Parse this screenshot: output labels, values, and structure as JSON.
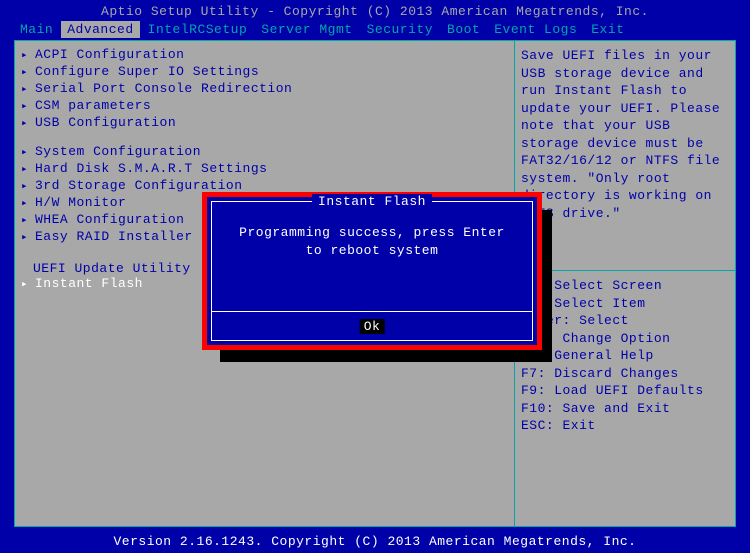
{
  "header": {
    "title": "Aptio Setup Utility - Copyright (C) 2013 American Megatrends, Inc."
  },
  "tabs": [
    {
      "label": "Main",
      "active": false
    },
    {
      "label": "Advanced",
      "active": true
    },
    {
      "label": "IntelRCSetup",
      "active": false
    },
    {
      "label": "Server Mgmt",
      "active": false
    },
    {
      "label": "Security",
      "active": false
    },
    {
      "label": "Boot",
      "active": false
    },
    {
      "label": "Event Logs",
      "active": false
    },
    {
      "label": "Exit",
      "active": false
    }
  ],
  "menu": {
    "group1": [
      "ACPI Configuration",
      "Configure Super IO Settings",
      "Serial Port Console Redirection",
      "CSM parameters",
      "USB Configuration"
    ],
    "group2": [
      "System Configuration",
      "Hard Disk S.M.A.R.T Settings",
      "3rd Storage Configuration",
      "H/W Monitor",
      "WHEA Configuration",
      "Easy RAID Installer"
    ],
    "section_label": "UEFI Update Utility",
    "highlighted": "Instant Flash"
  },
  "help": {
    "text": "Save UEFI files in your USB storage device and run Instant Flash to update your UEFI. Please note that your USB storage device must be FAT32/16/12 or NTFS file system.\n\"Only root directory is working on NTFS drive.\""
  },
  "keys": [
    "><: Select Screen",
    "^v: Select Item",
    "Enter: Select",
    "+/-: Change Option",
    "F1: General Help",
    "F7: Discard Changes",
    "F9: Load UEFI Defaults",
    "F10: Save and Exit",
    "ESC: Exit"
  ],
  "dialog": {
    "title": "Instant Flash",
    "message": "Programming success, press Enter to reboot system",
    "ok_label": "Ok"
  },
  "footer": {
    "text": "Version 2.16.1243. Copyright (C) 2013 American Megatrends, Inc."
  }
}
